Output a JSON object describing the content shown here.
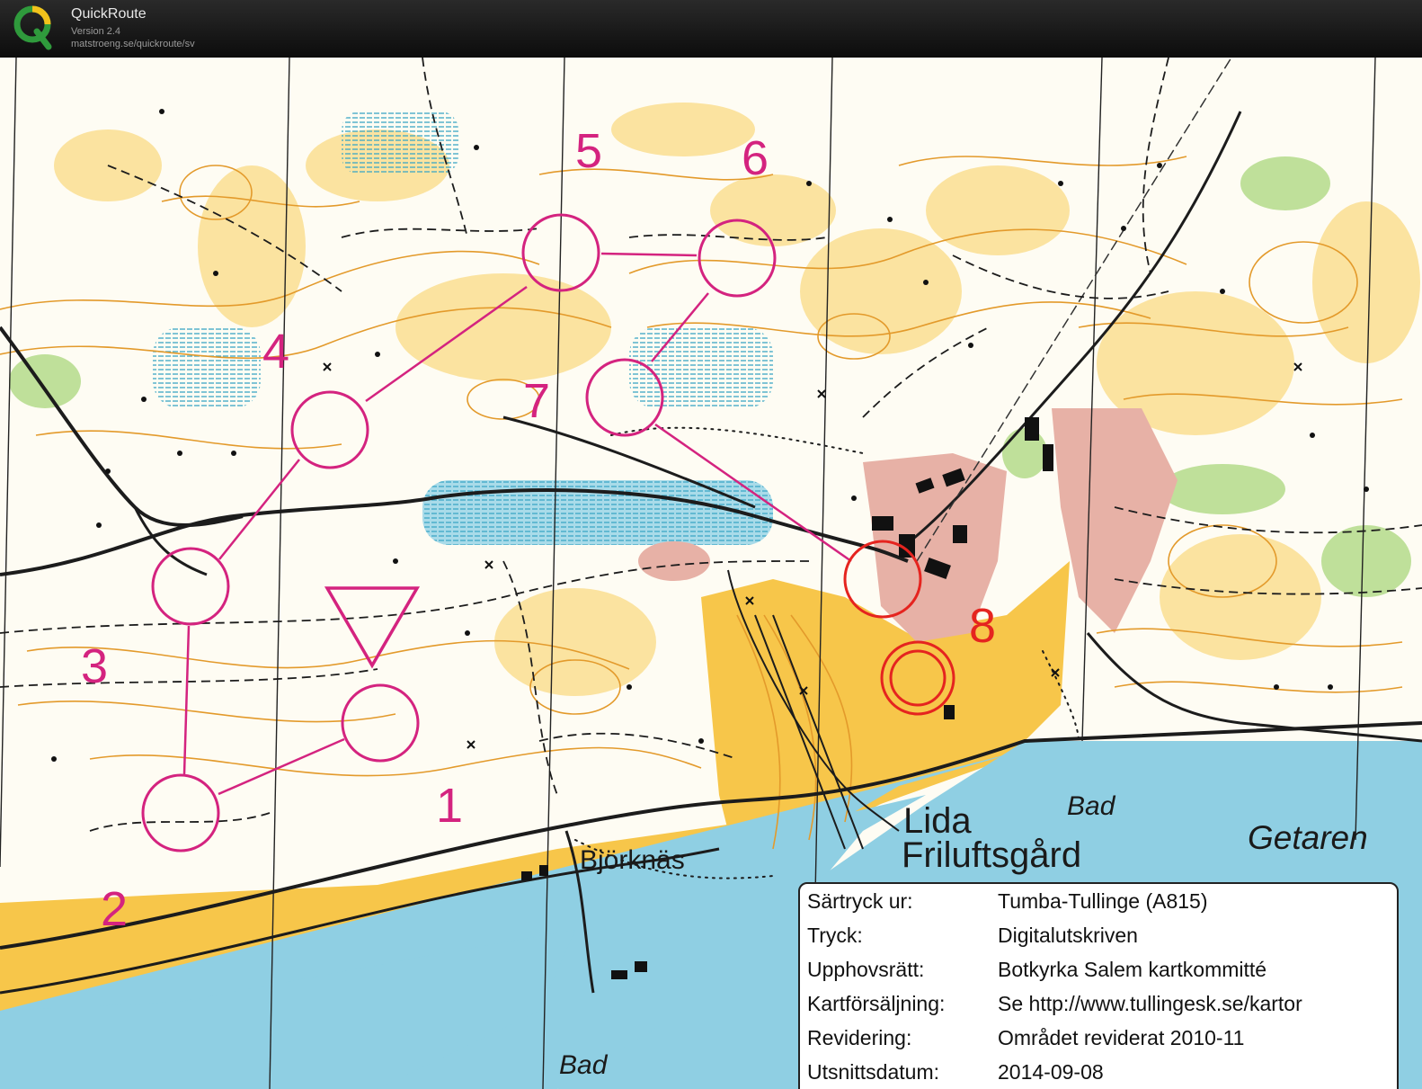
{
  "window": {
    "app_name": "QuickRoute",
    "version": "Version 2.4",
    "url": "matstroeng.se/quickroute/sv",
    "logo_icon": "quickroute-logo-icon"
  },
  "colors": {
    "course": "#d4237f",
    "course_red": "#e5241f",
    "forest_white": "#fefcf3",
    "open_yellow": "#f7c64a",
    "rough_yellow": "#fbe3a0",
    "water": "#8fcfe3",
    "marsh": "#6ec0d2",
    "built": "#e7b1a6",
    "green": "#bfe09a",
    "contour": "#e39a2b"
  },
  "course": {
    "start_label": "Start",
    "controls": [
      {
        "number": "1",
        "mx": 423,
        "my": 740
      },
      {
        "number": "2",
        "mx": 201,
        "my": 840
      },
      {
        "number": "3",
        "mx": 212,
        "my": 588
      },
      {
        "number": "4",
        "mx": 367,
        "my": 414
      },
      {
        "number": "5",
        "mx": 624,
        "my": 217
      },
      {
        "number": "6",
        "mx": 820,
        "my": 223
      },
      {
        "number": "7",
        "mx": 695,
        "my": 378
      },
      {
        "number": "8",
        "mx": 982,
        "my": 580
      }
    ],
    "finish": {
      "mx": 1021,
      "my": 690
    }
  },
  "place_names": [
    {
      "text": "Björknäs",
      "mx": 645,
      "my": 902,
      "size": 30,
      "italic": false,
      "weight": "normal"
    },
    {
      "text": "Lida",
      "mx": 1005,
      "my": 862,
      "size": 40,
      "italic": false,
      "weight": "normal"
    },
    {
      "text": "Friluftsgård",
      "mx": 1003,
      "my": 900,
      "size": 40,
      "italic": false,
      "weight": "normal"
    },
    {
      "text": "Bad",
      "mx": 1187,
      "my": 842,
      "size": 30,
      "italic": true,
      "weight": "normal"
    },
    {
      "text": "Getaren",
      "mx": 1388,
      "my": 880,
      "size": 37,
      "italic": true,
      "weight": "normal"
    },
    {
      "text": "Bad",
      "mx": 622,
      "my": 1130,
      "size": 30,
      "italic": true,
      "weight": "normal"
    }
  ],
  "legend": {
    "rows": [
      {
        "key": "Särtryck ur:",
        "value": "Tumba-Tullinge (A815)"
      },
      {
        "key": "Tryck:",
        "value": "Digitalutskriven"
      },
      {
        "key": "Upphovsrätt:",
        "value": "Botkyrka Salem kartkommitté"
      },
      {
        "key": "Kartförsäljning:",
        "value": "Se http://www.tullingesk.se/kartor"
      },
      {
        "key": "Revidering:",
        "value": "Området reviderat 2010-11"
      },
      {
        "key": "Utsnittsdatum:",
        "value": "2014-09-08"
      }
    ]
  }
}
